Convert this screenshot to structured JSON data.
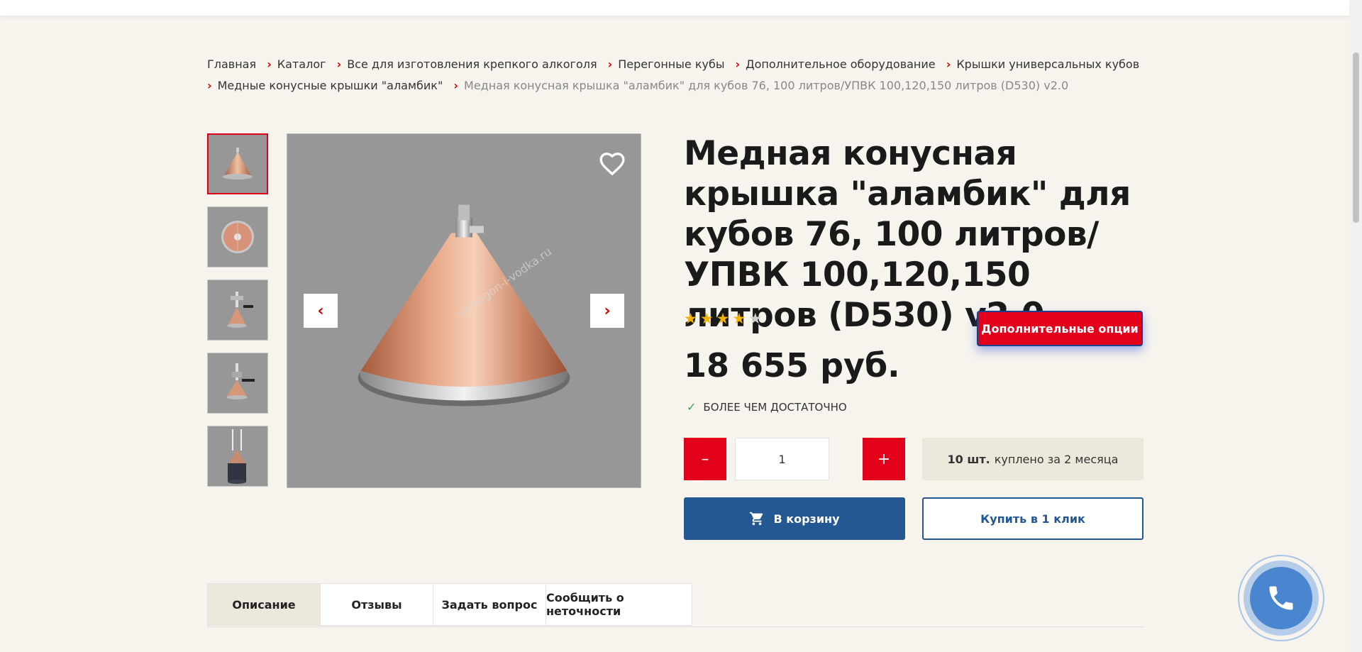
{
  "breadcrumb": {
    "items": [
      "Главная",
      "Каталог",
      "Все для изготовления крепкого алкоголя",
      "Перегонные кубы",
      "Дополнительное оборудование",
      "Крышки универсальных кубов",
      "Медные конусные крышки \"аламбик\""
    ],
    "current": "Медная конусная крышка \"аламбик\" для кубов 76, 100 литров/УПВК 100,120,150 литров (D530) v2.0"
  },
  "gallery": {
    "thumbnails": [
      "cone-side-view",
      "cone-top-view",
      "cone-with-fitting",
      "cone-with-valve",
      "cone-on-still"
    ],
    "active_index": 0,
    "watermark": "samogon-i-vodka.ru",
    "icons": {
      "prev": "chevron-left-icon",
      "next": "chevron-right-icon",
      "favorite": "heart-icon"
    }
  },
  "product": {
    "title": "Медная конусная крышка \"аламбик\" для кубов 76, 100 литров/УПВК 100,120,150 литров (D530) v2.0",
    "rating": 4,
    "rating_max": 5,
    "price": "18 655 руб.",
    "stock": "БОЛЕЕ ЧЕМ ДОСТАТОЧНО",
    "options_label": "Дополнительные опции"
  },
  "quantity": {
    "minus": "–",
    "value": "1",
    "plus": "+"
  },
  "bought": {
    "count": "10 шт.",
    "text": "куплено за 2 месяца"
  },
  "buttons": {
    "cart": "В корзину",
    "one_click": "Купить в 1 клик"
  },
  "tabs": [
    "Описание",
    "Отзывы",
    "Задать вопрос",
    "Сообщить о неточности"
  ],
  "colors": {
    "accent": "#e3001b",
    "primary": "#245893",
    "background": "#f7f4ee",
    "star": "#f2b400",
    "check": "#2fa84f"
  }
}
